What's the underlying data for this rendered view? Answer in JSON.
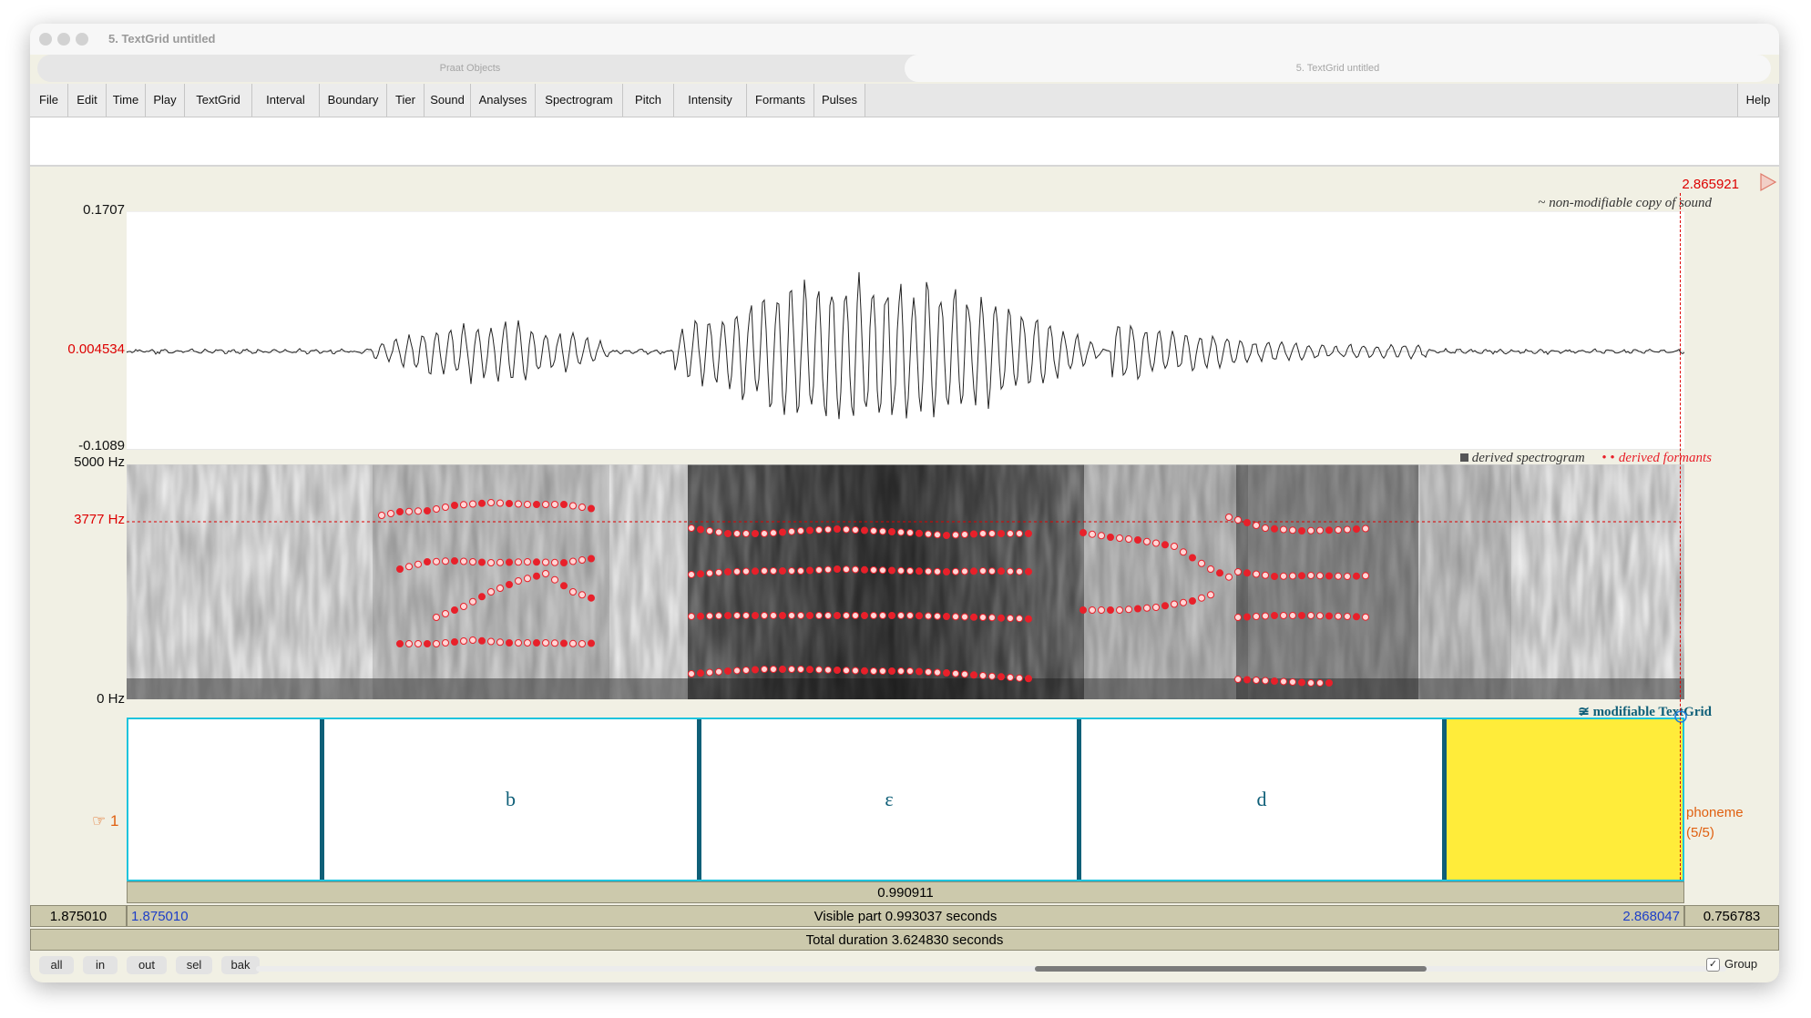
{
  "window": {
    "title": "5. TextGrid untitled",
    "tabs": [
      "Praat Objects",
      "5. TextGrid untitled"
    ]
  },
  "menu": [
    "File",
    "Edit",
    "Time",
    "Play",
    "TextGrid",
    "Interval",
    "Boundary",
    "Tier",
    "Sound",
    "Analyses",
    "Spectrogram",
    "Pitch",
    "Intensity",
    "Formants",
    "Pulses"
  ],
  "help_label": "Help",
  "cursor_time": "2.865921",
  "waveform": {
    "max_label": "0.1707",
    "zero_label": "0.004534",
    "min_label": "-0.1089",
    "legend": "non-modifiable copy of sound"
  },
  "spectrogram": {
    "top_label": "5000 Hz",
    "cursor_label": "3777 Hz",
    "bottom_label": "0 Hz",
    "legend_spectrogram": "derived spectrogram",
    "legend_formants": "derived formants"
  },
  "textgrid": {
    "legend": "modifiable TextGrid",
    "tier_number": "1",
    "tier_name": "phoneme",
    "tier_count": "(5/5)",
    "intervals": [
      "",
      "b",
      "ɛ",
      "d",
      ""
    ]
  },
  "selection": {
    "duration": "0.990911",
    "left_outside": "1.875010",
    "visible_start": "1.875010",
    "visible_part": "Visible part 0.993037 seconds",
    "visible_end": "2.868047",
    "right_outside": "0.756783",
    "total_duration": "Total duration 3.624830 seconds"
  },
  "buttons": {
    "all": "all",
    "in": "in",
    "out": "out",
    "sel": "sel",
    "bak": "bak",
    "group": "Group"
  },
  "colors": {
    "cursor": "#dd0000",
    "formant": "#e8202a",
    "textgrid_border": "#1ec4dd",
    "boundary": "#0f5f78",
    "selected_interval": "#ffec3a",
    "tier_label": "#e06010",
    "info_bar": "#ccc9ac"
  }
}
